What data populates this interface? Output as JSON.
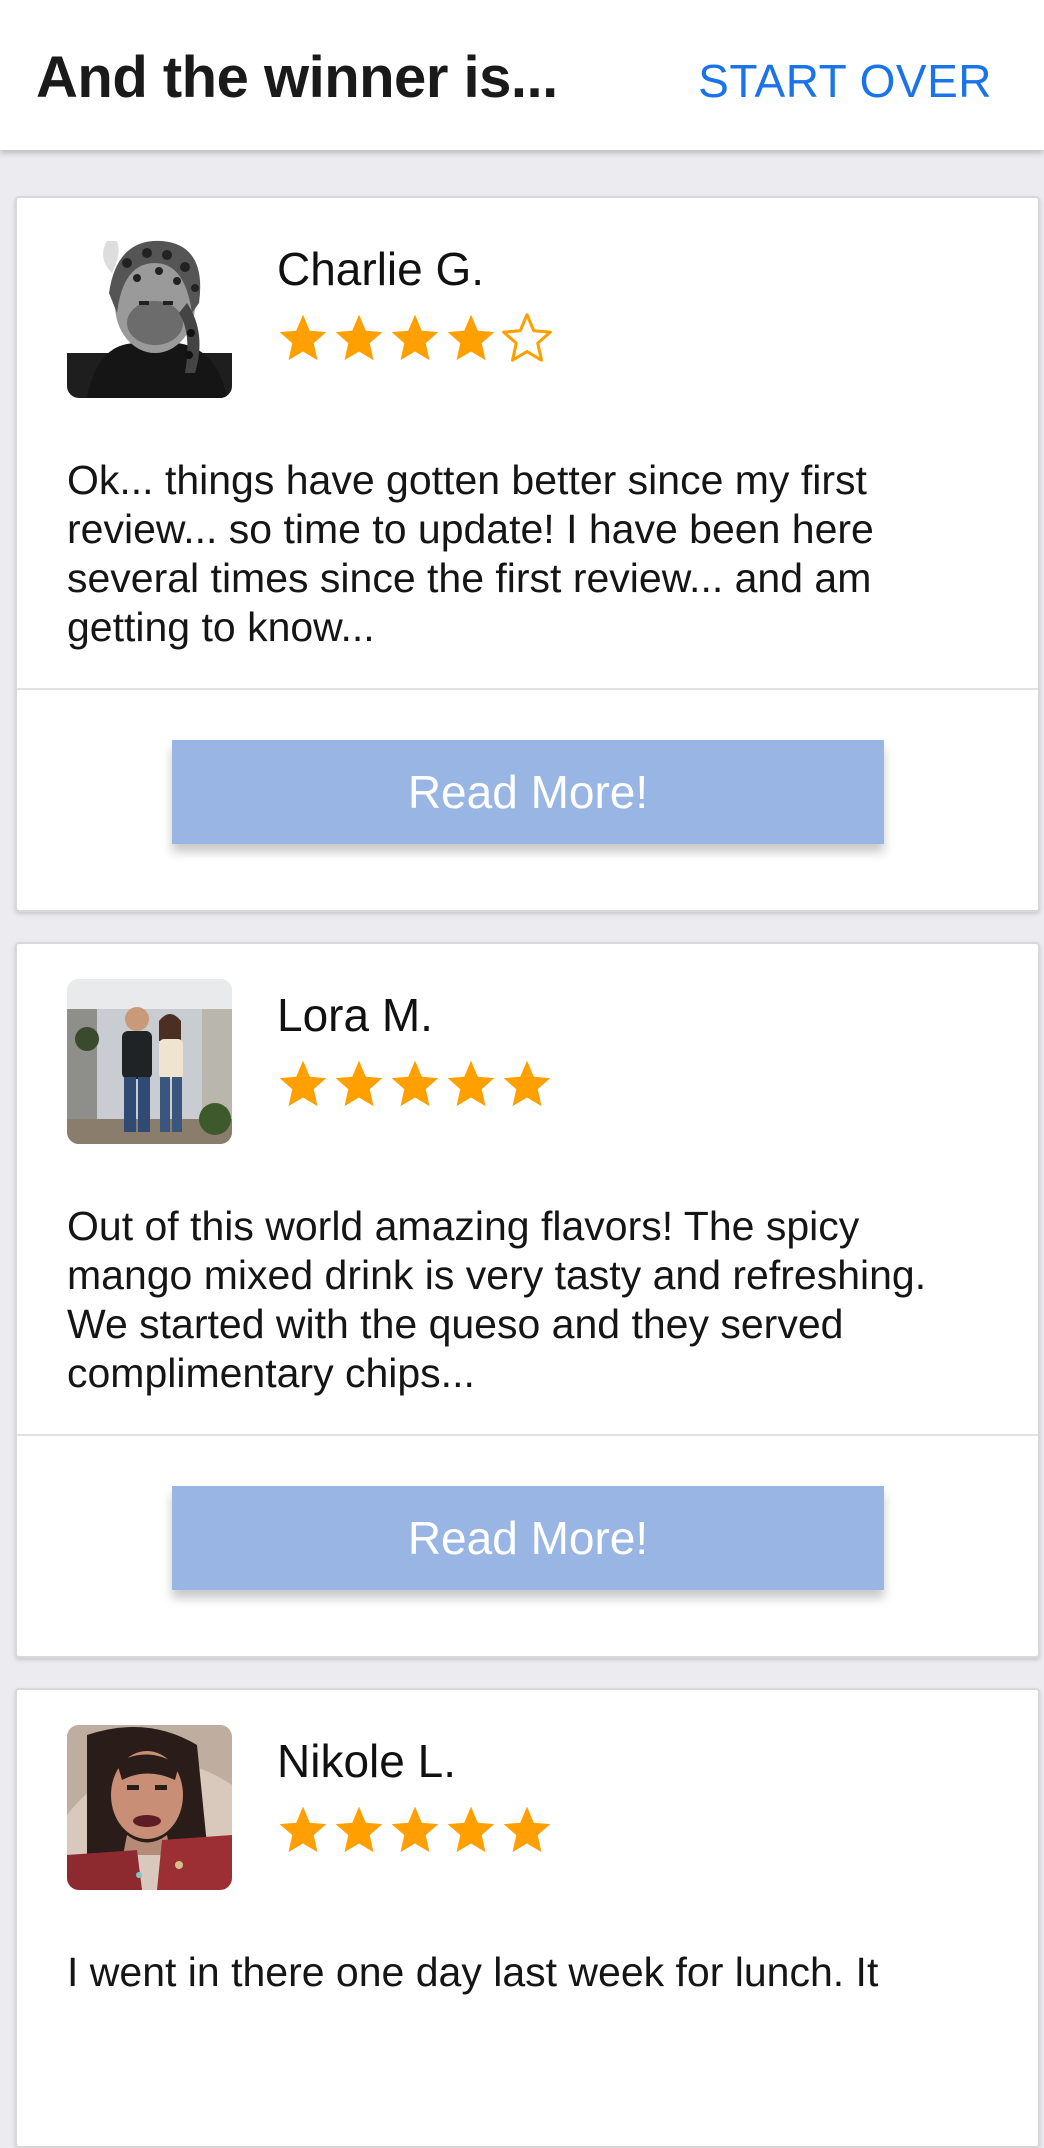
{
  "header": {
    "title": "And the winner is...",
    "action_label": "START OVER",
    "action_color": "#1a73e8"
  },
  "colors": {
    "star": "#ffa000",
    "button_bg": "#99b5e4",
    "button_text": "#ffffff"
  },
  "reviews": [
    {
      "name": "Charlie G.",
      "rating": 4,
      "max_rating": 5,
      "text": "Ok... things have gotten better since my first review... so time to update! I have been here several times since the first review... and am getting to know...",
      "button_label": "Read More!",
      "avatar": "bw-portrait-leopard-hat"
    },
    {
      "name": "Lora M.",
      "rating": 5,
      "max_rating": 5,
      "text": "Out of this world amazing flavors! The spicy mango mixed drink is very tasty and refreshing. We started with the queso and they served complimentary chips...",
      "button_label": "Read More!",
      "avatar": "couple-photo"
    },
    {
      "name": "Nikole L.",
      "rating": 5,
      "max_rating": 5,
      "text": "I went in there one day last week for lunch. It",
      "button_label": "",
      "avatar": "selfie-red-jacket"
    }
  ]
}
